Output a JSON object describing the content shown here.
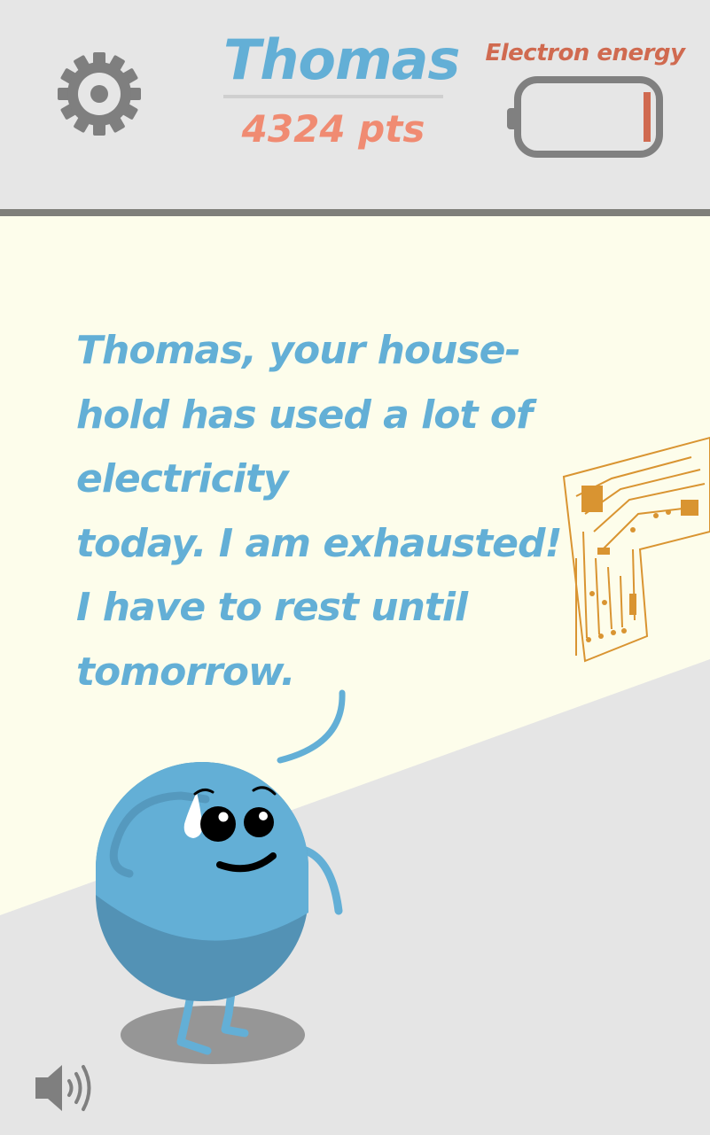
{
  "header": {
    "player_name": "Thomas",
    "points": "4324 pts",
    "energy_label": "Electron energy",
    "energy_level": 0.05,
    "settings_icon": "gear-icon"
  },
  "dialogue": {
    "lines": [
      "Thomas, your house-",
      "hold has used a lot of",
      "electricity",
      "today. I am exhausted!",
      "I have to rest until",
      "tomorrow."
    ]
  },
  "footer": {
    "sound_icon": "speaker-icon"
  },
  "colors": {
    "accent_blue": "#63afd6",
    "points_coral": "#f08b72",
    "energy_red": "#d06a50",
    "wall": "#fdfdeb",
    "floor": "#e5e5e5",
    "circuit": "#d99431"
  }
}
